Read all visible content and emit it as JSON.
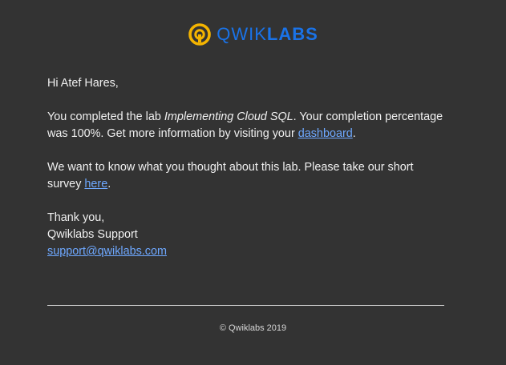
{
  "brand": {
    "text_light": "QWIK",
    "text_bold": "LABS",
    "colors": {
      "accent": "#1a73e8",
      "mark": "#f4b400"
    },
    "icon": "qwiklabs-logo-icon"
  },
  "email": {
    "greeting": "Hi Atef Hares,",
    "completion": {
      "before": "You completed the lab ",
      "lab_name": "Implementing Cloud SQL",
      "after": ". Your completion percentage was 100%. Get more information by visiting your ",
      "link_text": "dashboard",
      "end": "."
    },
    "survey": {
      "before": "We want to know what you thought about this lab. Please take our short survey ",
      "link_text": "here",
      "end": "."
    },
    "signoff": {
      "thanks": "Thank you,",
      "name": "Qwiklabs Support",
      "email_link": "support@qwiklabs.com"
    }
  },
  "footer": {
    "copyright": "© Qwiklabs 2019"
  },
  "theme": {
    "background": "#333333",
    "text": "#f0f0f0",
    "link": "#6ea8ff"
  }
}
